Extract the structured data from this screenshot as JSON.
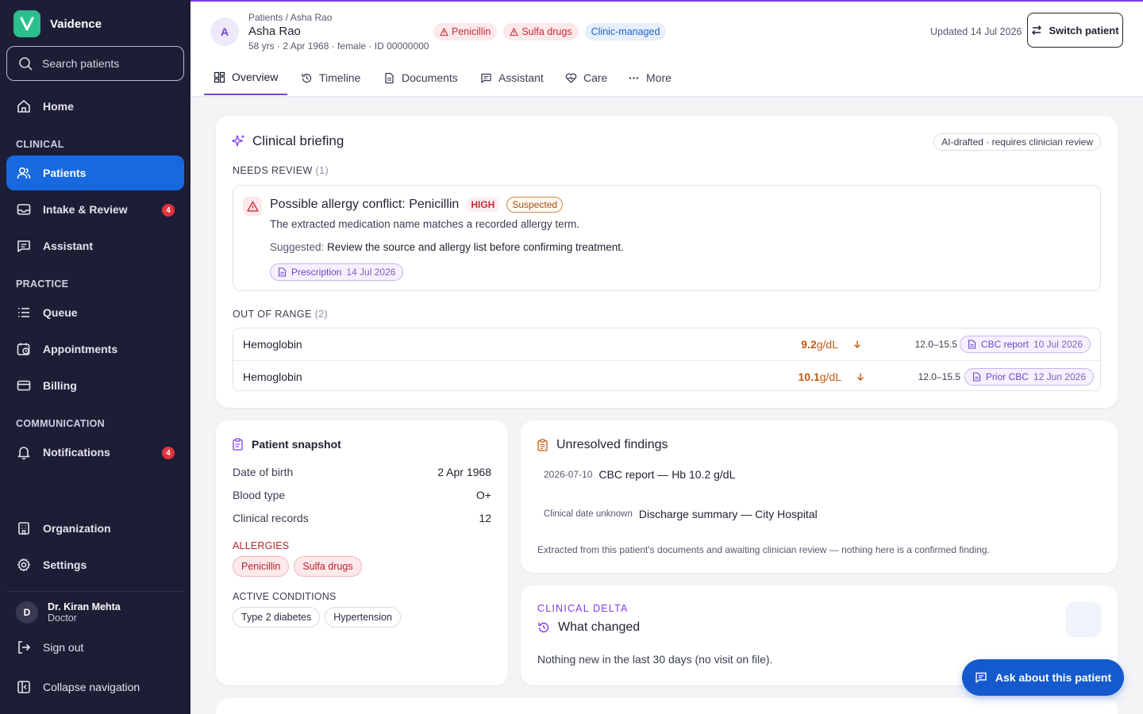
{
  "app": {
    "name": "Vaidence"
  },
  "sidebar": {
    "search_placeholder": "Search patients",
    "home": "Home",
    "section_clinical": "CLINICAL",
    "patients": "Patients",
    "intake": "Intake & Review",
    "intake_badge": "4",
    "assistant": "Assistant",
    "section_practice": "PRACTICE",
    "queue": "Queue",
    "appointments": "Appointments",
    "billing": "Billing",
    "section_communication": "COMMUNICATION",
    "notifications": "Notifications",
    "notifications_badge": "4",
    "organization": "Organization",
    "settings": "Settings",
    "user": {
      "initial": "D",
      "name": "Dr. Kiran Mehta",
      "role": "Doctor"
    },
    "sign_out": "Sign out",
    "collapse": "Collapse navigation"
  },
  "header": {
    "avatar_initial": "A",
    "breadcrumb": "Patients / Asha Rao",
    "patient_name": "Asha Rao",
    "patient_meta": "58 yrs · 2 Apr 1968 · female · ID 00000000",
    "chips": {
      "allergy1": "Penicillin",
      "allergy2": "Sulfa drugs",
      "managed": "Clinic-managed"
    },
    "updated": "Updated 14 Jul 2026",
    "switch_patient": "Switch patient"
  },
  "tabs": {
    "overview": "Overview",
    "timeline": "Timeline",
    "documents": "Documents",
    "assistant": "Assistant",
    "care": "Care",
    "more": "More"
  },
  "briefing": {
    "title": "Clinical briefing",
    "ai_note": "AI-drafted · requires clinician review",
    "needs_review_label": "NEEDS REVIEW",
    "needs_review_count": "(1)",
    "alert": {
      "title": "Possible allergy conflict: Penicillin",
      "severity": "HIGH",
      "status": "Suspected",
      "description": "The extracted medication name matches a recorded allergy term.",
      "suggested_label": "Suggested:",
      "suggested_text": "Review the source and allergy list before confirming treatment.",
      "source_name": "Prescription",
      "source_date": "14 Jul 2026"
    },
    "out_of_range_label": "OUT OF RANGE",
    "out_of_range_count": "(2)",
    "ranges": [
      {
        "name": "Hemoglobin",
        "value": "9.2",
        "unit": "g/dL",
        "ref": "12.0–15.5",
        "source": "CBC report",
        "date": "10 Jul 2026"
      },
      {
        "name": "Hemoglobin",
        "value": "10.1",
        "unit": "g/dL",
        "ref": "12.0–15.5",
        "source": "Prior CBC",
        "date": "12 Jun 2026"
      }
    ]
  },
  "snapshot": {
    "title": "Patient snapshot",
    "dob_label": "Date of birth",
    "dob": "2 Apr 1968",
    "blood_label": "Blood type",
    "blood": "O+",
    "records_label": "Clinical records",
    "records": "12",
    "allergies_label": "ALLERGIES",
    "allergies": [
      "Penicillin",
      "Sulfa drugs"
    ],
    "conditions_label": "ACTIVE CONDITIONS",
    "conditions": [
      "Type 2 diabetes",
      "Hypertension"
    ]
  },
  "findings": {
    "title": "Unresolved findings",
    "items": [
      {
        "date": "2026-07-10",
        "text": "CBC report — Hb 10.2 g/dL"
      },
      {
        "date": "Clinical date unknown",
        "text": "Discharge summary — City Hospital"
      }
    ],
    "note": "Extracted from this patient's documents and awaiting clinician review — nothing here is a confirmed finding."
  },
  "delta": {
    "label": "CLINICAL DELTA",
    "title": "What changed",
    "text": "Nothing new in the last 30 days (no visit on file)."
  },
  "ask_button": "Ask about this patient",
  "colors": {
    "sidebar": "#1e1d36",
    "active": "#1769e0",
    "accent": "#7c3aed",
    "danger": "#c52b3a",
    "warning": "#c55a11"
  }
}
